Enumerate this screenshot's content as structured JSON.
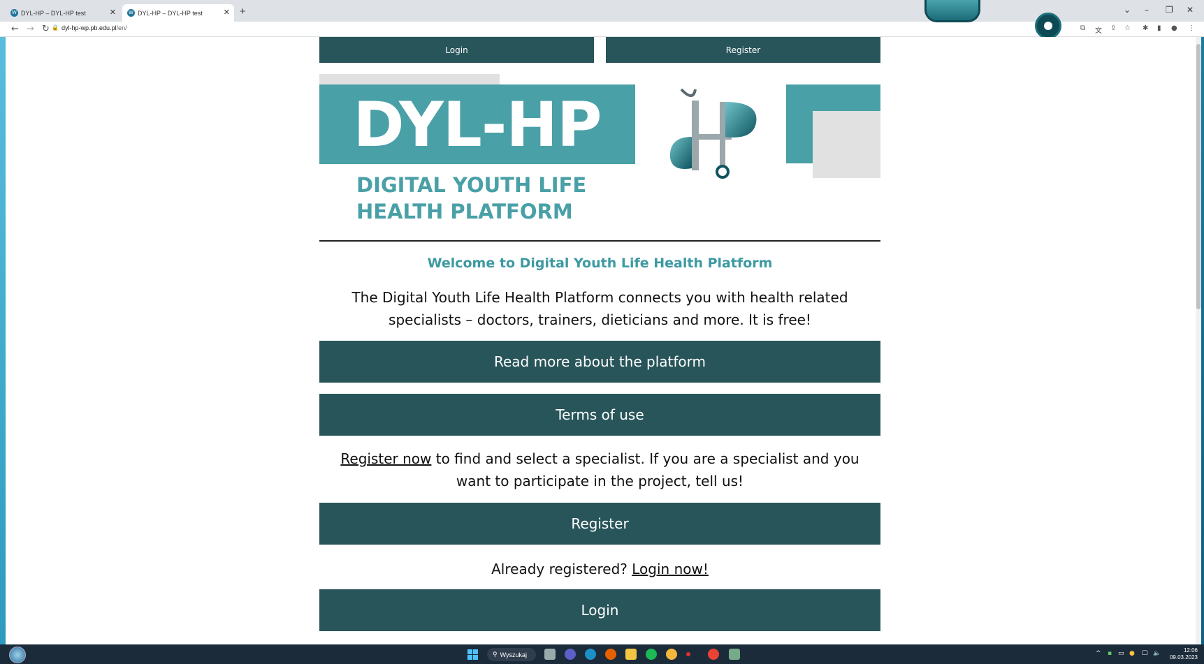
{
  "browser": {
    "tabs": [
      {
        "title": "DYL-HP – DYL-HP test",
        "active": false
      },
      {
        "title": "DYL-HP – DYL-HP test",
        "active": true
      }
    ],
    "url_host": "dyl-hp-wp.pb.edu.pl",
    "url_path": "/en/"
  },
  "page": {
    "top_login": "Login",
    "top_register": "Register",
    "logo_text": "DYL-HP",
    "logo_subtitle_1": "DIGITAL YOUTH LIFE",
    "logo_subtitle_2": "HEALTH PLATFORM",
    "welcome": "Welcome to Digital Youth Life Health Platform",
    "intro": "The Digital Youth Life Health Platform connects you with health related specialists – doctors, trainers, dieticians and more. It is free!",
    "read_more": "Read more about the platform",
    "terms": "Terms of use",
    "register_link": "Register now",
    "register_text": " to find and select a specialist. If you are a specialist and you want to participate in the project, tell us!",
    "register_btn": "Register",
    "already_text": "Already registered? ",
    "login_link": "Login now!",
    "login_btn": "Login"
  },
  "taskbar": {
    "search": "Wyszukaj",
    "time": "12:06",
    "date": "09.03.2023"
  },
  "colors": {
    "button": "#28555a",
    "teal": "#4aa0a7"
  }
}
